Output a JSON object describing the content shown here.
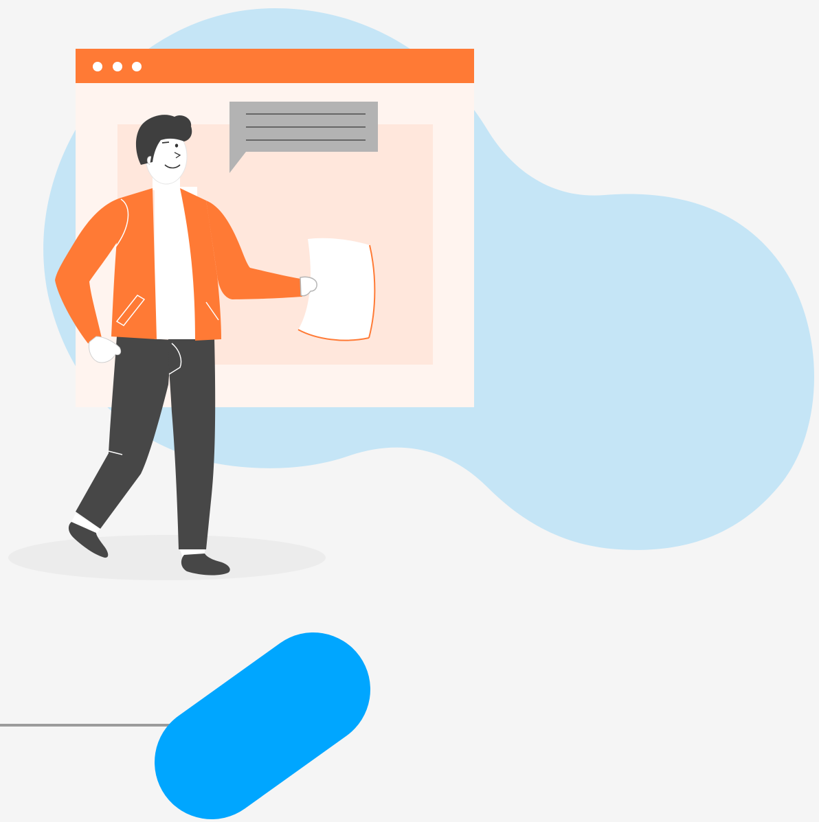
{
  "illustration": {
    "colors": {
      "background": "#f5f5f5",
      "blob": "#c5e5f6",
      "window_titlebar": "#ff7a35",
      "window_body": "#fff4ef",
      "window_panel": "#ffe7dc",
      "speech_bubble": "#b3b3b3",
      "jacket": "#ff7a35",
      "trousers": "#474747",
      "hair": "#3f3f3f",
      "paper": "#ffffff",
      "pill_accent": "#00a6ff",
      "ground_line": "#9b9b9b",
      "shadow": "#ececec"
    },
    "icons": {
      "window_dots": [
        "dot-icon",
        "dot-icon",
        "dot-icon"
      ],
      "speech_bubble": "speech-bubble-icon",
      "paper": "document-icon"
    }
  }
}
